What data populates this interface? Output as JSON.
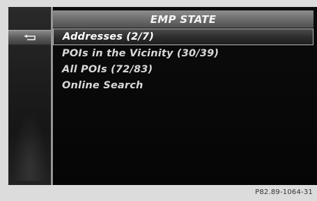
{
  "header": {
    "title": "EMP STATE"
  },
  "back_button": {
    "icon": "back-arrow-icon"
  },
  "menu": {
    "items": [
      {
        "label": "Addresses  (2/7)",
        "selected": true
      },
      {
        "label": "POIs in the Vicinity  (30/39)",
        "selected": false
      },
      {
        "label": "All POIs  (72/83)",
        "selected": false
      },
      {
        "label": "Online Search",
        "selected": false
      }
    ]
  },
  "footer": {
    "code": "P82.89-1064-31"
  },
  "colors": {
    "background": "#050505",
    "title_bar": "#7a7a7a",
    "text": "#d8d8d8",
    "selection_border": "#b8b8b8",
    "page": "#dcdcdc"
  }
}
